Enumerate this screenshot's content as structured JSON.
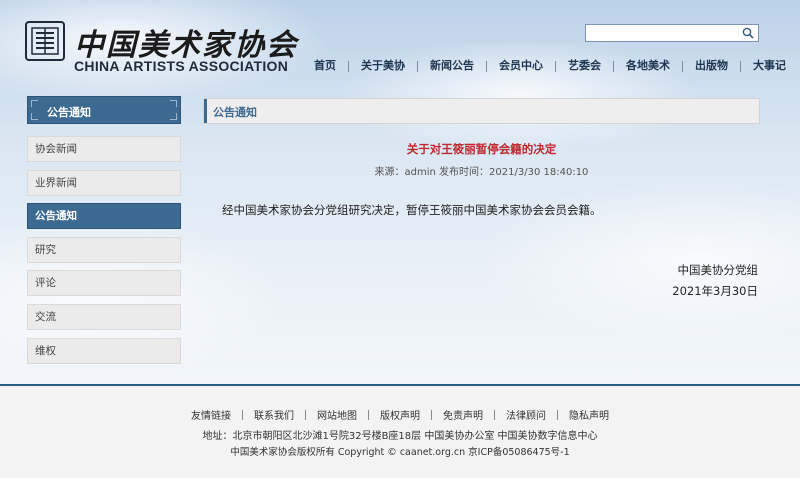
{
  "header": {
    "logo_cn": "中国美术家协会",
    "logo_en": "CHINA ARTISTS ASSOCIATION",
    "search": {
      "value": "",
      "placeholder": ""
    },
    "nav": [
      "首页",
      "关于美协",
      "新闻公告",
      "会员中心",
      "艺委会",
      "各地美术",
      "出版物",
      "大事记"
    ]
  },
  "sidebar": {
    "title": "公告通知",
    "items": [
      {
        "label": "协会新闻",
        "active": false
      },
      {
        "label": "业界新闻",
        "active": false
      },
      {
        "label": "公告通知",
        "active": true
      },
      {
        "label": "研究",
        "active": false
      },
      {
        "label": "评论",
        "active": false
      },
      {
        "label": "交流",
        "active": false
      },
      {
        "label": "维权",
        "active": false
      }
    ]
  },
  "main": {
    "section_title": "公告通知",
    "article": {
      "title": "关于对王筱丽暂停会籍的决定",
      "meta": "来源：admin 发布时间：2021/3/30 18:40:10",
      "body": "经中国美术家协会分党组研究决定，暂停王筱丽中国美术家协会会员会籍。",
      "signature_org": "中国美协分党组",
      "signature_date": "2021年3月30日"
    }
  },
  "footer": {
    "links": [
      "友情链接",
      "联系我们",
      "网站地图",
      "版权声明",
      "免责声明",
      "法律顾问",
      "隐私声明"
    ],
    "address": "地址：北京市朝阳区北沙滩1号院32号楼B座18层  中国美协办公室  中国美协数字信息中心",
    "copyright": "中国美术家协会版权所有 Copyright © caanet.org.cn 京ICP备05086475号-1"
  },
  "colors": {
    "accent_blue": "#3d6a91",
    "title_red": "#c0282d",
    "footer_line": "#2f5b85"
  }
}
